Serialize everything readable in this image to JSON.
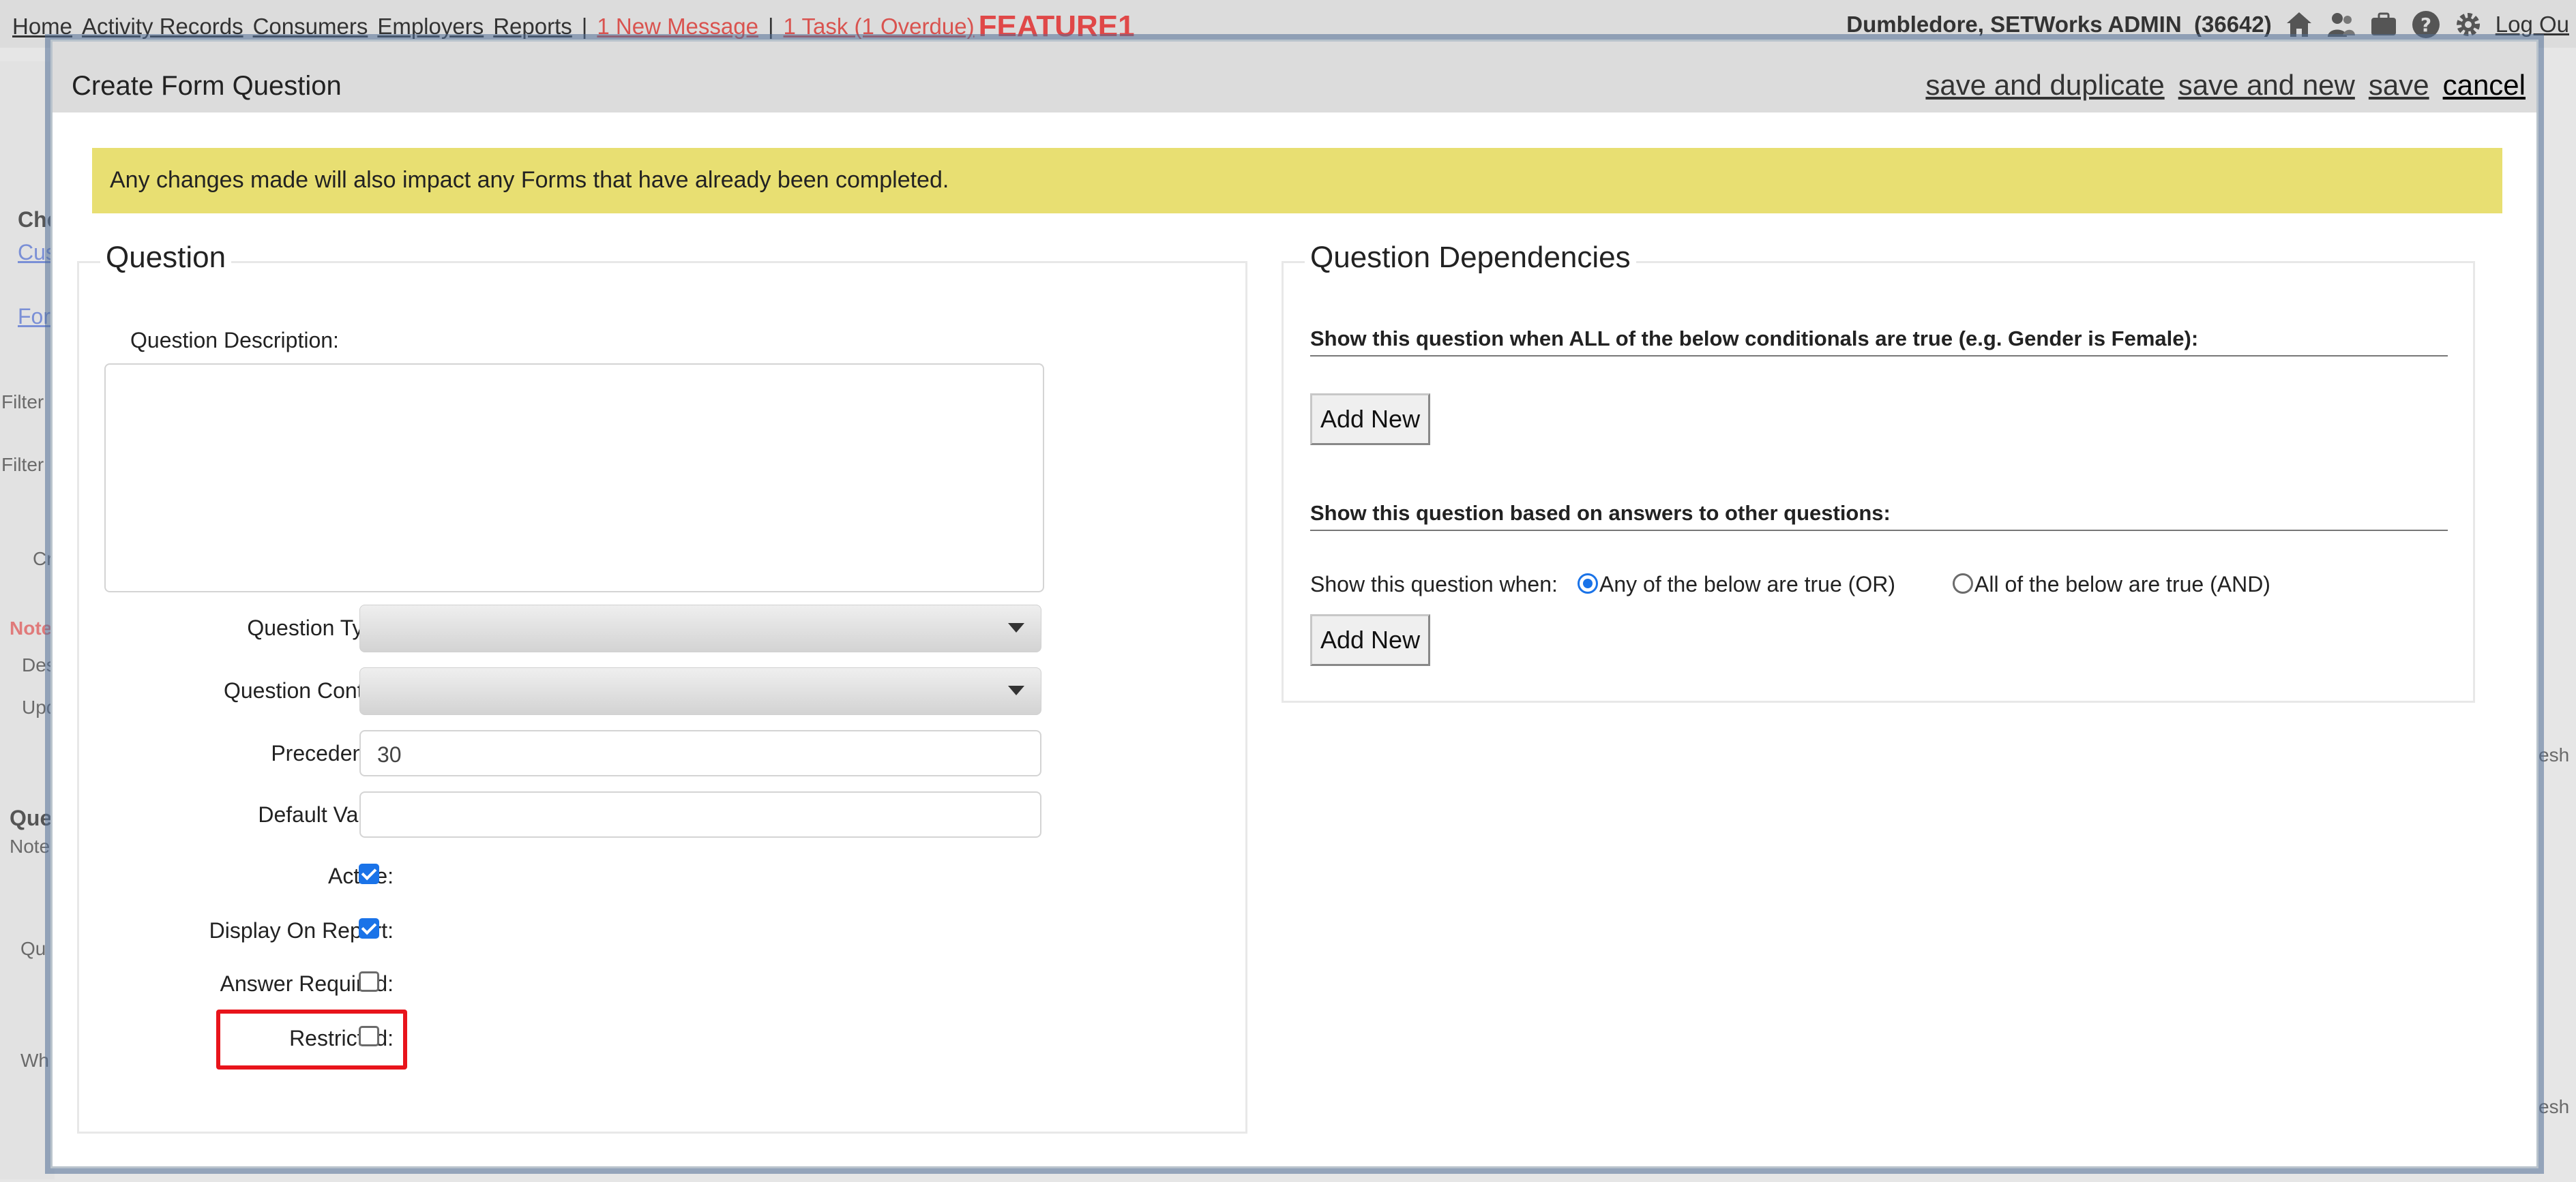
{
  "nav": {
    "links": [
      "Home",
      "Activity Records",
      "Consumers",
      "Employers",
      "Reports"
    ],
    "separator": "|",
    "new_message": "1 New Message",
    "task": "1 Task (1 Overdue)",
    "environment": "FEATURE1",
    "user": "Dumbledore, SETWorks ADMIN",
    "user_id": "(36642)",
    "logout": "Log Ou",
    "icons": [
      "home-icon",
      "users-icon",
      "briefcase-icon",
      "help-icon",
      "gear-icon"
    ]
  },
  "background": {
    "che": "Che",
    "cus": "Cus",
    "for": "For",
    "filter1": "Filter B",
    "filter2": "Filter B",
    "tab": "Cr",
    "notes_red": "Notes",
    "des": "Des",
    "upd": "Upd",
    "ques": "Ques",
    "notes2": "Notes",
    "qu": "Qu",
    "wh": "Wh",
    "esh1": "esh",
    "esh2": "esh"
  },
  "modal": {
    "title": "Create Form Question",
    "actions": {
      "save_and_duplicate": "save and duplicate",
      "save_and_new": "save and new",
      "save": "save",
      "cancel": "cancel"
    },
    "alert": "Any changes made will also impact any Forms that have already been completed."
  },
  "question": {
    "legend": "Question",
    "description_label": "Question Description:",
    "description_value": "",
    "type_label": "Question Type:",
    "type_value": "",
    "control_label": "Question Control:",
    "control_value": "",
    "precedence_label": "Precedence:",
    "precedence_value": "30",
    "default_label": "Default Value:",
    "default_value": "",
    "active_label": "Active:",
    "active_checked": true,
    "display_label": "Display On Report:",
    "display_checked": true,
    "required_label": "Answer Required:",
    "required_checked": false,
    "restricted_label": "Restricted:",
    "restricted_checked": false
  },
  "dependencies": {
    "legend": "Question Dependencies",
    "conditionals_heading": "Show this question when ALL of the below conditionals are true (e.g. Gender is Female):",
    "add_new_1": "Add New",
    "answers_heading": "Show this question based on answers to other questions:",
    "show_when_label": "Show this question when:",
    "option_or": "Any of the below are true (OR)",
    "option_and": "All of the below are true (AND)",
    "selected_option": "or",
    "add_new_2": "Add New"
  },
  "colors": {
    "alert_background": "#e8df72",
    "checkbox_accent": "#1a73e8",
    "highlight_border": "#e8141b",
    "environment_text": "#e04848",
    "link_red": "#d9534f"
  }
}
